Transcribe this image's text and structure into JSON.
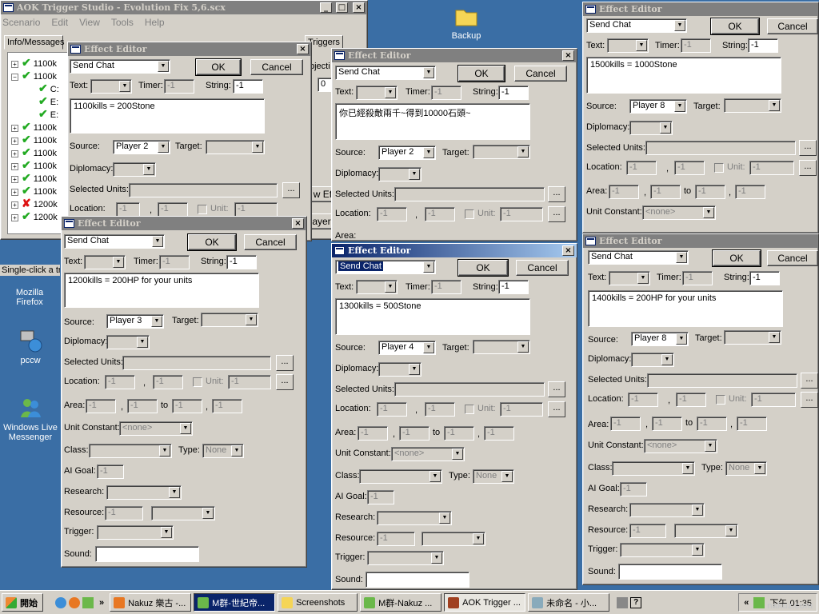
{
  "main": {
    "title": "AOK Trigger Studio - Evolution Fix 5,6.scx",
    "menu": [
      "Scenario",
      "Edit",
      "View",
      "Tools",
      "Help"
    ],
    "tabs": [
      "Info/Messages",
      "Triggers"
    ],
    "tree": [
      "1100k",
      "1100k",
      "C:",
      "E:",
      "E:",
      "1100k",
      "1100k",
      "1100k",
      "1100k",
      "1100k",
      "1100k",
      "1200k",
      "1200k"
    ],
    "hint": "Single-click a tri",
    "partial_labels": [
      "bjecti",
      "0",
      "w Eff",
      "ayers"
    ]
  },
  "desktop": {
    "icons": [
      {
        "label": "Backup"
      },
      {
        "label": "Mozilla Firefox"
      },
      {
        "label": "pccw"
      },
      {
        "label": "Windows Live Messenger"
      }
    ]
  },
  "labels": {
    "title": "Effect Editor",
    "ok": "OK",
    "cancel": "Cancel",
    "text": "Text:",
    "timer": "Timer:",
    "string": "String:",
    "source": "Source:",
    "target": "Target:",
    "diplomacy": "Diplomacy:",
    "selected_units": "Selected Units:",
    "location": "Location:",
    "unit": "Unit:",
    "area": "Area:",
    "to": "to",
    "unit_constant": "Unit Constant:",
    "class": "Class:",
    "type": "Type:",
    "ai_goal": "AI Goal:",
    "research": "Research:",
    "resource": "Resource:",
    "trigger": "Trigger:",
    "sound": "Sound:",
    "comma": ",",
    "ellipsis": "..."
  },
  "editors": [
    {
      "effect": "Send Chat",
      "timer": "-1",
      "string": "-1",
      "message": "1100kills = 200Stone",
      "source": "Player 2",
      "neg": "-1",
      "none": "<none>",
      "type_val": "None"
    },
    {
      "effect": "Send Chat",
      "timer": "-1",
      "string": "-1",
      "message": "1200kills = 200HP for your units",
      "source": "Player 3",
      "neg": "-1",
      "none": "<none>",
      "type_val": "None"
    },
    {
      "effect": "Send Chat",
      "timer": "-1",
      "string": "-1",
      "message": "你已經殺敵兩千~得到10000石頭~",
      "source": "Player 2",
      "neg": "-1",
      "none": "<none>",
      "type_val": "None"
    },
    {
      "effect": "Send Chat",
      "timer": "-1",
      "string": "-1",
      "message": "1300kills = 500Stone",
      "source": "Player 4",
      "neg": "-1",
      "none": "<none>",
      "type_val": "None"
    },
    {
      "effect": "Send Chat",
      "timer": "-1",
      "string": "-1",
      "message": "1500kills = 1000Stone",
      "source": "Player 8",
      "neg": "-1",
      "none": "<none>",
      "type_val": "None"
    },
    {
      "effect": "Send Chat",
      "timer": "-1",
      "string": "-1",
      "message": "1400kills = 200HP for your units",
      "source": "Player 8",
      "neg": "-1",
      "none": "<none>",
      "type_val": "None"
    }
  ],
  "taskbar": {
    "start": "開始",
    "items": [
      "Nakuz 樂古 -...",
      "M群-世紀帝...",
      "Screenshots",
      "M群-Nakuz ...",
      "AOK Trigger ...",
      "未命名 - 小..."
    ],
    "clock": "下午 01:35",
    "watermark": "nakuz.com"
  },
  "colors": {
    "desktop": "#3a6ea5",
    "title_active": "#0a246a",
    "title_inactive": "#808080",
    "face": "#d4d0c8"
  }
}
